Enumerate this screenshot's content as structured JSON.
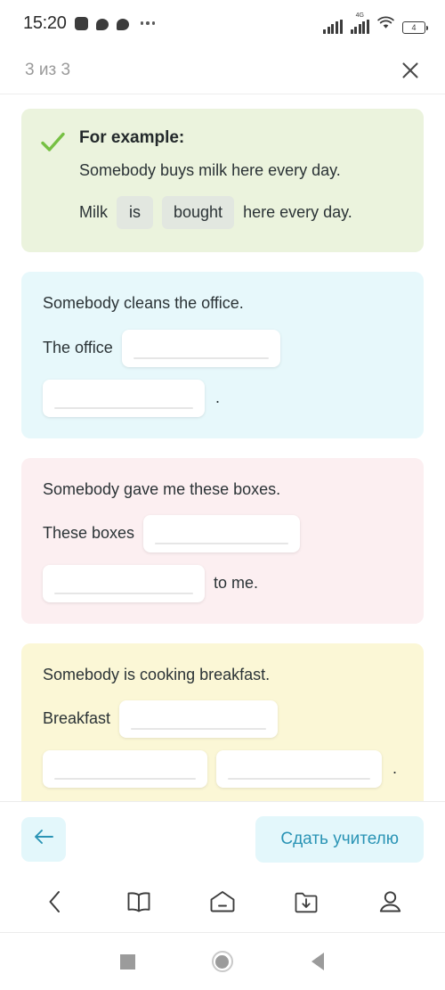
{
  "status_bar": {
    "time": "15:20",
    "icons_left": [
      "app-square-icon",
      "chat-bubble-icon",
      "chat-bubble-icon",
      "more-dots-icon"
    ],
    "network_label": "4G",
    "battery_level": "4",
    "icons_right": [
      "signal-bars-icon",
      "signal-bars-4g-icon",
      "wifi-icon",
      "battery-icon"
    ]
  },
  "header": {
    "progress": "3 из 3",
    "close_label": "×"
  },
  "example_card": {
    "title": "For example:",
    "prompt": "Somebody buys milk here every day.",
    "answer_prefix": "Milk",
    "answer_word_1": "is",
    "answer_word_2": "bought",
    "answer_suffix": "here every day.",
    "check_color": "#76c043",
    "bg_color": "#ebf3dd"
  },
  "questions": [
    {
      "bg_color": "#e7f8fb",
      "prompt": "Somebody cleans the office.",
      "prefix": "The office",
      "blank_1": "",
      "blank_2": "",
      "suffix": "",
      "period": "."
    },
    {
      "bg_color": "#fceff1",
      "prompt": "Somebody gave me these boxes.",
      "prefix": "These boxes",
      "blank_1": "",
      "blank_2": "",
      "suffix": "to me.",
      "period": ""
    },
    {
      "bg_color": "#fbf7d6",
      "prompt": "Somebody is cooking breakfast.",
      "prefix": "Breakfast",
      "blank_1": "",
      "blank_2": "",
      "blank_3": "",
      "suffix": "",
      "period": "."
    }
  ],
  "action_bar": {
    "back_icon": "arrow-left-icon",
    "submit_label": "Сдать учителю",
    "accent_color": "#2a94b5",
    "button_bg": "#e3f7fb"
  },
  "app_nav": {
    "items": [
      {
        "icon": "chevron-left-icon",
        "name": "nav-back"
      },
      {
        "icon": "book-icon",
        "name": "nav-library"
      },
      {
        "icon": "home-icon",
        "name": "nav-home"
      },
      {
        "icon": "folder-download-icon",
        "name": "nav-downloads"
      },
      {
        "icon": "person-icon",
        "name": "nav-profile"
      }
    ]
  },
  "system_nav": {
    "items": [
      {
        "icon": "square-recents-icon",
        "name": "system-recents"
      },
      {
        "icon": "circle-home-icon",
        "name": "system-home"
      },
      {
        "icon": "triangle-back-icon",
        "name": "system-back"
      }
    ]
  }
}
